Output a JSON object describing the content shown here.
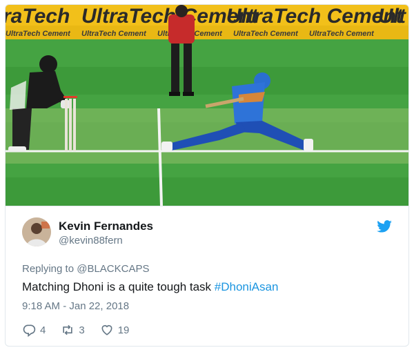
{
  "media": {
    "banner_brand": "UltraTech Cement",
    "banner_small": "UltraTech Cement",
    "banner_left_fragment": "raTech",
    "banner_right_fragment": "Ult",
    "colors": {
      "field": "#3d9a3a",
      "banner": "#f2c01a"
    }
  },
  "tweet": {
    "author_name": "Kevin Fernandes",
    "author_handle": "@kevin88fern",
    "reply_prefix": "Replying to",
    "reply_to": "@BLACKCAPS",
    "text_plain": "Matching Dhoni is a quite tough task ",
    "hashtag": "#DhoniAsan",
    "timestamp": "9:18 AM - Jan 22, 2018",
    "replies": "4",
    "retweets": "3",
    "likes": "19",
    "icons": [
      "twitter-bird-icon",
      "reply-icon",
      "retweet-icon",
      "like-icon"
    ],
    "colors": {
      "accent": "#1da1f2",
      "link": "#1b95e0",
      "muted": "#657786"
    }
  }
}
